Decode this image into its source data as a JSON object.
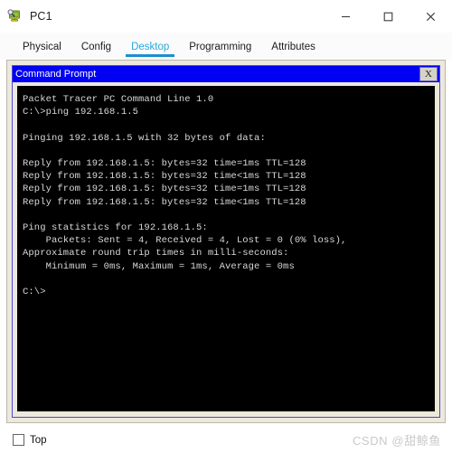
{
  "window": {
    "title": "PC1",
    "icon": "pc-device-icon",
    "controls": {
      "minimize": "—",
      "maximize": "☐",
      "close": "✕",
      "minimize_name": "minimize-button",
      "maximize_name": "maximize-button",
      "close_name": "close-button"
    }
  },
  "tabs": [
    {
      "label": "Physical",
      "active": false
    },
    {
      "label": "Config",
      "active": false
    },
    {
      "label": "Desktop",
      "active": true
    },
    {
      "label": "Programming",
      "active": false
    },
    {
      "label": "Attributes",
      "active": false
    }
  ],
  "command_prompt": {
    "title": "Command Prompt",
    "close_label": "X",
    "banner": "Packet Tracer PC Command Line 1.0",
    "prompt": "C:\\>",
    "command": "ping 192.168.1.5",
    "target_ip": "192.168.1.5",
    "bytes": "32",
    "lines": [
      "Packet Tracer PC Command Line 1.0",
      "C:\\>ping 192.168.1.5",
      "",
      "Pinging 192.168.1.5 with 32 bytes of data:",
      "",
      "Reply from 192.168.1.5: bytes=32 time=1ms TTL=128",
      "Reply from 192.168.1.5: bytes=32 time<1ms TTL=128",
      "Reply from 192.168.1.5: bytes=32 time=1ms TTL=128",
      "Reply from 192.168.1.5: bytes=32 time<1ms TTL=128",
      "",
      "Ping statistics for 192.168.1.5:",
      "    Packets: Sent = 4, Received = 4, Lost = 0 (0% loss),",
      "Approximate round trip times in milli-seconds:",
      "    Minimum = 0ms, Maximum = 1ms, Average = 0ms",
      "",
      "C:\\>"
    ],
    "statistics": {
      "sent": "4",
      "received": "4",
      "lost": "0",
      "loss_percent": "0%",
      "minimum": "0ms",
      "maximum": "1ms",
      "average": "0ms"
    },
    "colors": {
      "titlebar": "#0000f2",
      "terminal_bg": "#000000",
      "terminal_fg": "#d8d8d8",
      "frame_border": "#4f45d0"
    }
  },
  "bottom_bar": {
    "top_checkbox_label": "Top",
    "top_checkbox_checked": false,
    "watermark_prefix": "CSDN @",
    "watermark_user": "甜鲸鱼",
    "watermark_full": "CSDN @甜鲸鱼"
  },
  "theme": {
    "panel_bg": "#ece9dc",
    "accent": "#29a8dd",
    "tab_underline": "#1a8fd0"
  }
}
